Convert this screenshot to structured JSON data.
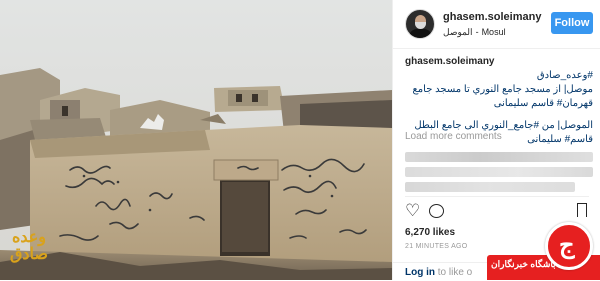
{
  "post": {
    "username": "ghasem.soleimany",
    "location_arabic": "الموصل",
    "location_sep": "-",
    "location": "Mosul",
    "follow_label": "Follow"
  },
  "caption": {
    "user": "ghasem.soleimany",
    "hashtag": "#وعده_صادق",
    "line1": "موصل| از مسجد جامع النوري تا مسجد جامع قهرمان# قاسم سليمانى",
    "line2": "الموصل| من #جامع_النوري الى جامع البطل قاسم# سليمانى"
  },
  "comments": {
    "load_more": "Load more comments"
  },
  "stats": {
    "likes": "6,270 likes",
    "time": "21 MINUTES AGO"
  },
  "login": {
    "link": "Log in",
    "suffix": " to like o"
  },
  "watermark": {
    "line1": "وعده",
    "line2": "صادق"
  },
  "badge": {
    "text": "باشگاه خبرنگاران",
    "glyph": "ج"
  },
  "colors": {
    "follow": "#3897f0",
    "badge": "#e62020",
    "link": "#003569"
  }
}
